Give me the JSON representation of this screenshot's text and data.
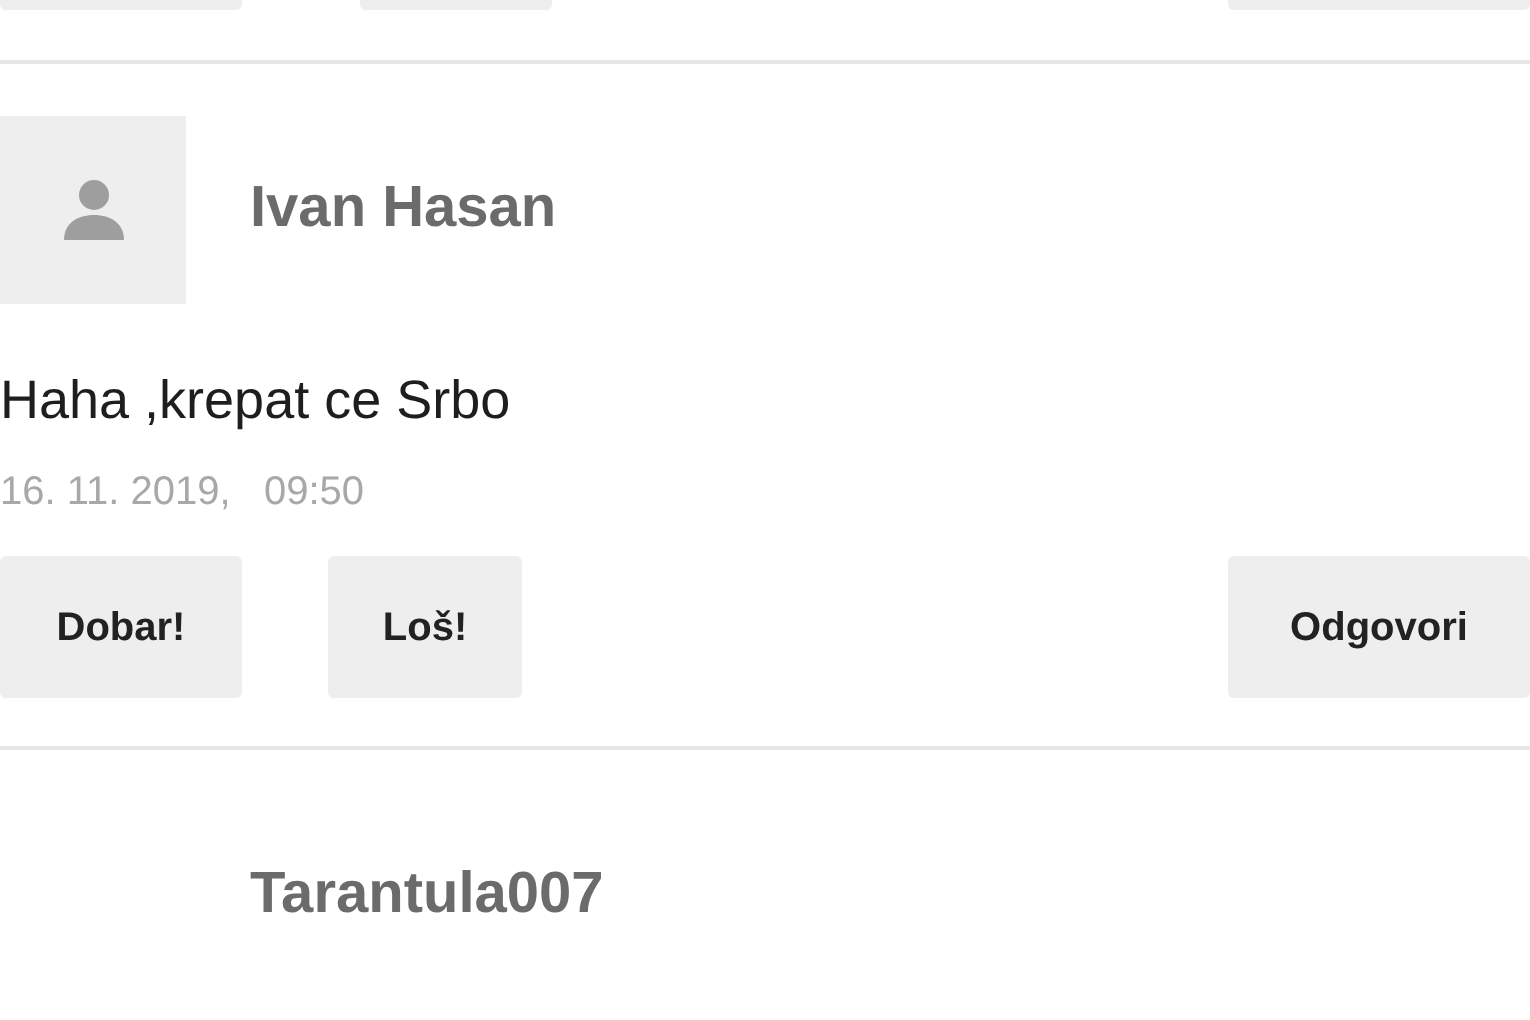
{
  "comments": [
    {
      "author": "Ivan Hasan",
      "avatar": true,
      "text": "Haha ,krepat ce Srbo",
      "date": "16. 11. 2019,   09:50",
      "buttons": [
        "Dobar!",
        "Loš!",
        "Odgovori"
      ]
    },
    {
      "author": "Tarantula007",
      "avatar": false
    }
  ]
}
